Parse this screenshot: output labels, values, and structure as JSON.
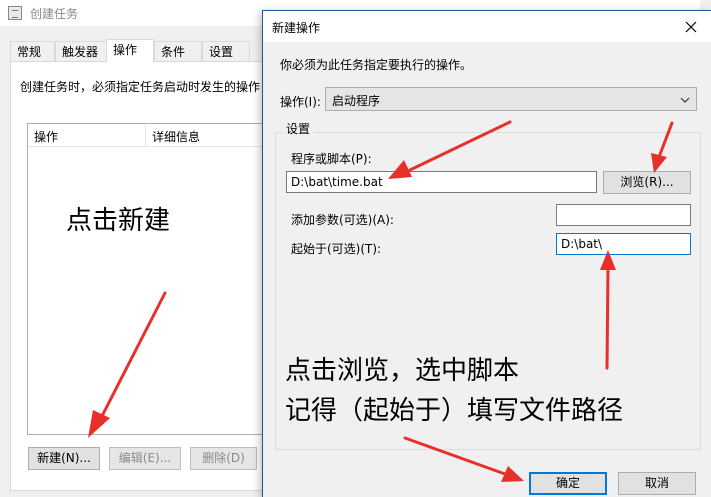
{
  "bg_window": {
    "title": "创建任务",
    "tabs": [
      "常规",
      "触发器",
      "操作",
      "条件",
      "设置"
    ],
    "description": "创建任务时，必须指定任务启动时发生的操作",
    "columns": [
      "操作",
      "详细信息"
    ],
    "buttons": {
      "new": "新建(N)...",
      "edit": "编辑(E)...",
      "delete": "删除(D)"
    }
  },
  "dialog": {
    "title": "新建操作",
    "instruction": "你必须为此任务指定要执行的操作。",
    "operation_label": "操作(I):",
    "operation_value": "启动程序",
    "settings_label": "设置",
    "program_label": "程序或脚本(P):",
    "program_value": "D:\\bat\\time.bat",
    "browse_button": "浏览(R)...",
    "args_label": "添加参数(可选)(A):",
    "args_value": "",
    "start_in_label": "起始于(可选)(T):",
    "start_in_value": "D:\\bat\\",
    "ok_button": "确定",
    "cancel_button": "取消"
  },
  "annotations": {
    "click_new": "点击新建",
    "click_browse": "点击浏览，选中脚本",
    "remember_path": "记得（起始于）填写文件路径"
  },
  "colors": {
    "arrow": "#e8302a",
    "focus": "#0078d7"
  }
}
